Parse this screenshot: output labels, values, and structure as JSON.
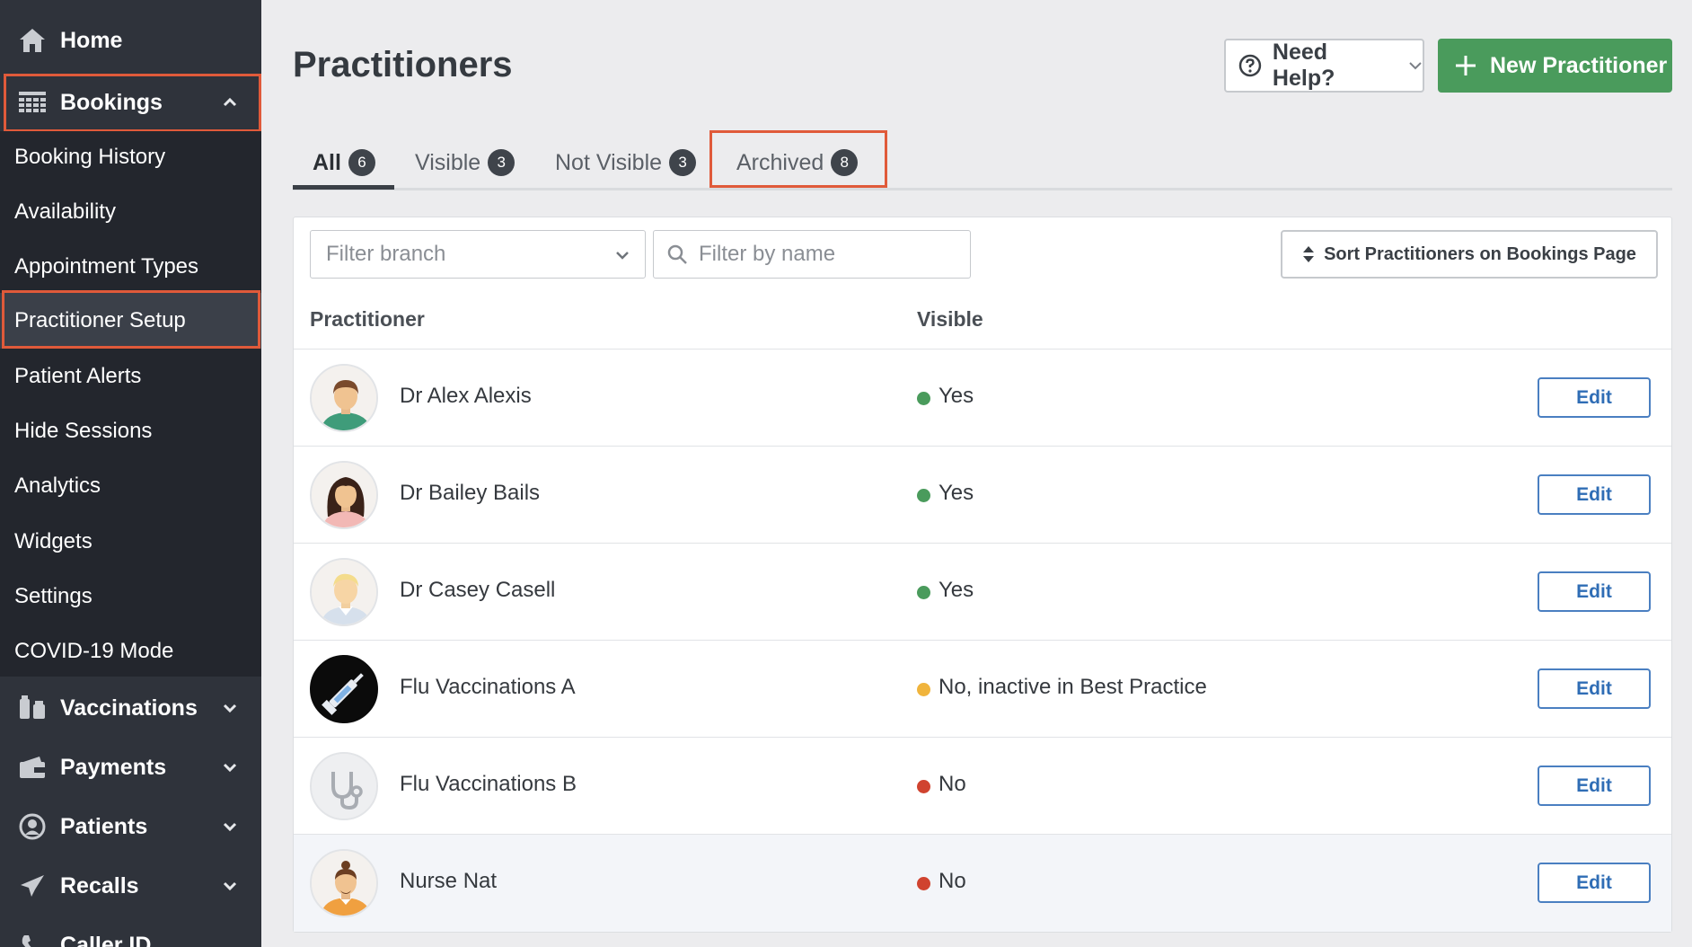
{
  "sidebar": {
    "home_label": "Home",
    "bookings_label": "Bookings",
    "sub_items": [
      {
        "label": "Booking History"
      },
      {
        "label": "Availability"
      },
      {
        "label": "Appointment Types"
      },
      {
        "label": "Practitioner Setup"
      },
      {
        "label": "Patient Alerts"
      },
      {
        "label": "Hide Sessions"
      },
      {
        "label": "Analytics"
      },
      {
        "label": "Widgets"
      },
      {
        "label": "Settings"
      },
      {
        "label": "COVID-19 Mode"
      }
    ],
    "active_sub_item": "Practitioner Setup",
    "sections": [
      {
        "label": "Vaccinations",
        "icon": "vaccinations-icon"
      },
      {
        "label": "Payments",
        "icon": "payments-icon"
      },
      {
        "label": "Patients",
        "icon": "patients-icon"
      },
      {
        "label": "Recalls",
        "icon": "recalls-icon"
      },
      {
        "label": "Caller ID",
        "icon": "caller-id-icon"
      }
    ]
  },
  "header": {
    "title": "Practitioners",
    "help_label": "Need Help?",
    "new_label": "New Practitioner"
  },
  "tabs": [
    {
      "label": "All",
      "count": "6",
      "active": true
    },
    {
      "label": "Visible",
      "count": "3"
    },
    {
      "label": "Not Visible",
      "count": "3"
    },
    {
      "label": "Archived",
      "count": "8"
    }
  ],
  "filters": {
    "branch_placeholder": "Filter branch",
    "name_placeholder": "Filter by name",
    "sort_label": "Sort Practitioners on Bookings Page"
  },
  "table": {
    "columns": [
      "Practitioner",
      "Visible"
    ],
    "edit_label": "Edit",
    "rows": [
      {
        "name": "Dr Alex Alexis",
        "visible": "Yes",
        "status": "green",
        "avatar": "male-doctor-avatar-icon"
      },
      {
        "name": "Dr Bailey Bails",
        "visible": "Yes",
        "status": "green",
        "avatar": "female-doctor-avatar-icon"
      },
      {
        "name": "Dr Casey Casell",
        "visible": "Yes",
        "status": "green",
        "avatar": "blond-doctor-avatar-icon"
      },
      {
        "name": "Flu Vaccinations A",
        "visible": "No, inactive in Best Practice",
        "status": "yellow",
        "avatar": "syringe-avatar-icon"
      },
      {
        "name": "Flu Vaccinations B",
        "visible": "No",
        "status": "red",
        "avatar": "stethoscope-avatar-icon"
      },
      {
        "name": "Nurse Nat",
        "visible": "No",
        "status": "red",
        "avatar": "nurse-avatar-icon"
      }
    ]
  },
  "colors": {
    "sidebar_bg": "#2f333b",
    "sidebar_sub_bg": "#23262d",
    "accent_green": "#4a9b5c",
    "highlight_red": "#e05a3a",
    "edit_blue": "#2f6db5",
    "status_green": "#4a9b5c",
    "status_yellow": "#f0b43c",
    "status_red": "#d0432f"
  }
}
